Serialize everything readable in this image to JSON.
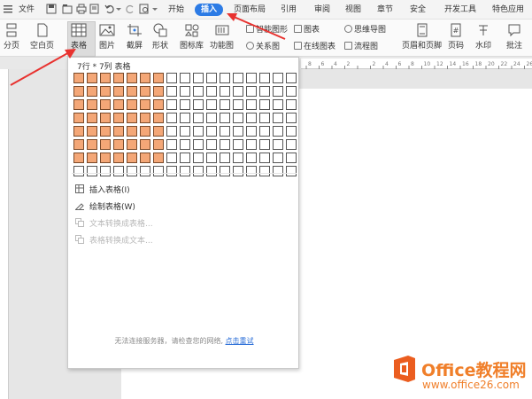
{
  "menu": {
    "file_label": "文件",
    "tabs": [
      {
        "label": "开始"
      },
      {
        "label": "插入"
      },
      {
        "label": "页面布局"
      },
      {
        "label": "引用"
      },
      {
        "label": "审阅"
      },
      {
        "label": "视图"
      },
      {
        "label": "章节"
      },
      {
        "label": "安全"
      },
      {
        "label": "开发工具"
      },
      {
        "label": "特色应用"
      }
    ],
    "active_tab": "插入",
    "accent_color": "#2c7be5"
  },
  "ribbon": {
    "page_break": "分页",
    "blank_page": "空白页",
    "table": "表格",
    "picture": "图片",
    "screenshot": "截屏",
    "shapes": "形状",
    "icon_library": "图标库",
    "function_chart": "功能图",
    "smart_art": "智能图形",
    "relation_chart": "关系图",
    "chart": "图表",
    "online_chart": "在线图表",
    "mind_map": "思维导图",
    "flowchart": "流程图",
    "header_footer": "页眉和页脚",
    "page_number": "页码",
    "watermark": "水印",
    "comment": "批注"
  },
  "table_dropdown": {
    "title": "7行 * 7列 表格",
    "rows_selected": 7,
    "cols_selected": 7,
    "grid_rows": 8,
    "grid_cols": 17,
    "highlight_color": "#f4a777",
    "items": [
      {
        "label": "插入表格(I)",
        "enabled": true
      },
      {
        "label": "绘制表格(W)",
        "enabled": true
      },
      {
        "label": "文本转换成表格...",
        "enabled": false
      },
      {
        "label": "表格转换成文本...",
        "enabled": false
      }
    ],
    "footer_text": "无法连接服务器，请检查您的网络,",
    "footer_link": "点击重试"
  },
  "ruler": {
    "marks": [
      "8",
      "6",
      "4",
      "2",
      "",
      "2",
      "4",
      "6",
      "8",
      "10",
      "12",
      "14",
      "16",
      "18",
      "20",
      "22",
      "24",
      "26"
    ]
  },
  "watermark": {
    "name": "Office教程网",
    "url": "www.office26.com",
    "color": "#f07f2a"
  }
}
